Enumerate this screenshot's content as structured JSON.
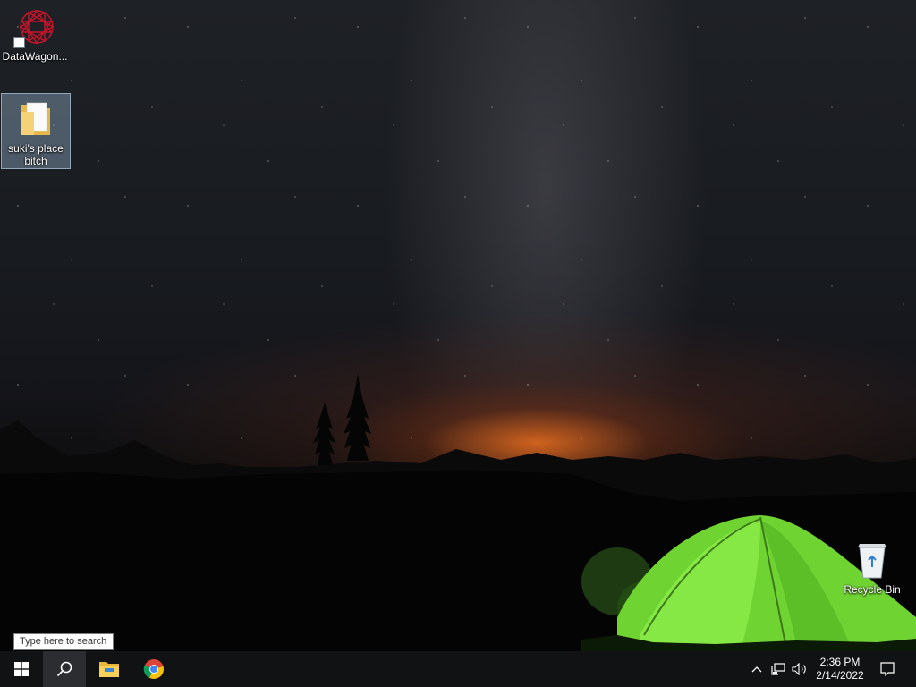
{
  "desktop": {
    "icons": [
      {
        "label": "DataWagon..."
      },
      {
        "label": "suki's place bitch"
      },
      {
        "label": "Recycle Bin"
      }
    ]
  },
  "search": {
    "placeholder": "Type here to search"
  },
  "taskbar": {
    "pinned": [
      "start-icon",
      "search-icon",
      "file-explorer-icon",
      "chrome-icon"
    ],
    "tray": {
      "icons": [
        "chevron-up-icon",
        "network-icon",
        "volume-icon"
      ],
      "time": "2:36 PM",
      "date": "2/14/2022"
    }
  },
  "colors": {
    "taskbar": "#101214",
    "tent": "#7ee23a",
    "horizon_glow": "#eb6e1e"
  }
}
